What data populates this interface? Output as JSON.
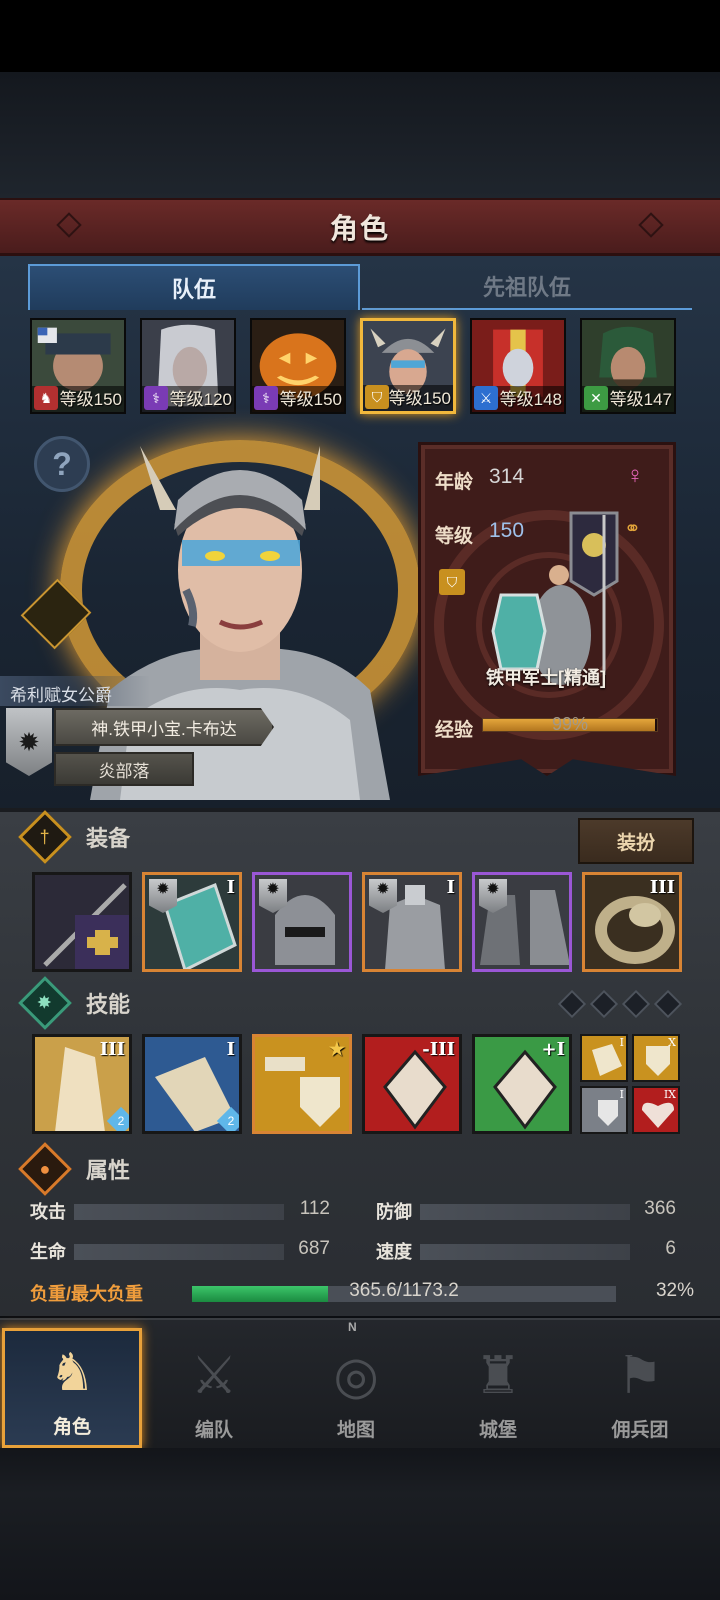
{
  "header": {
    "title": "角色"
  },
  "tabs": [
    {
      "label": "队伍",
      "active": true
    },
    {
      "label": "先祖队伍",
      "active": false
    }
  ],
  "roster": [
    {
      "level": "等级150",
      "class_icon": "horse-icon",
      "class_color": "#b23030",
      "face_color": "#4b5a4a"
    },
    {
      "level": "等级120",
      "class_icon": "staff-icon",
      "class_color": "#7a3bb5",
      "face_color": "#7d7f88"
    },
    {
      "level": "等级150",
      "class_icon": "staff-icon",
      "class_color": "#7a3bb5",
      "face_color": "#d97b1e"
    },
    {
      "level": "等级150",
      "class_icon": "shield-icon",
      "class_color": "#c8901f",
      "face_color": "#6a6f78",
      "selected": true
    },
    {
      "level": "等级148",
      "class_icon": "sword-icon",
      "class_color": "#2d6fd0",
      "face_color": "#b3362d"
    },
    {
      "level": "等级147",
      "class_icon": "crossed-swords-icon",
      "class_color": "#3d9b43",
      "face_color": "#3f5a3c"
    }
  ],
  "character": {
    "title": "希利赋女公爵",
    "name": "神.铁甲小宝.卡布达",
    "tribe": "炎部落",
    "age_label": "年龄",
    "age": "314",
    "level_label": "等级",
    "level": "150",
    "gender_icon": "female-icon",
    "unit": "铁甲军士[精通]",
    "exp_label": "经验",
    "exp_text": "99%",
    "exp_fraction": 0.99
  },
  "equipment": {
    "label": "装备",
    "dress_button": "装扮",
    "slots": [
      {
        "name": "banner-item",
        "rarity": "none",
        "rank": ""
      },
      {
        "name": "shield-item",
        "rarity": "orange",
        "rank": "I"
      },
      {
        "name": "helmet-item",
        "rarity": "purple",
        "rank": ""
      },
      {
        "name": "armor-item",
        "rarity": "orange",
        "rank": "I"
      },
      {
        "name": "boots-item",
        "rarity": "purple",
        "rank": ""
      },
      {
        "name": "ring-item",
        "rarity": "orange",
        "rank": "III"
      }
    ]
  },
  "skills": {
    "label": "技能",
    "slots": [
      {
        "name": "slash-skill",
        "color": "#caa04a",
        "rank": "III",
        "gem": "2"
      },
      {
        "name": "strike-skill",
        "color": "#2e5a92",
        "rank": "I",
        "gem": "2"
      },
      {
        "name": "guard-skill",
        "color": "#c9921f",
        "rank": ""
      },
      {
        "name": "red-crystal-skill",
        "color": "#b21e1e",
        "rank": "-III"
      },
      {
        "name": "green-crystal-skill",
        "color": "#3a9a45",
        "rank": "+I"
      }
    ],
    "passives": [
      {
        "name": "armor-passive",
        "color": "#c9921f",
        "rank": "I"
      },
      {
        "name": "shield-passive",
        "color": "#c9921f",
        "rank": "X"
      },
      {
        "name": "defense-passive",
        "color": "#7b8088",
        "rank": "I"
      },
      {
        "name": "heart-passive",
        "color": "#b21e1e",
        "rank": "IX"
      }
    ]
  },
  "attributes": {
    "label": "属性",
    "attack_label": "攻击",
    "attack": "112",
    "defense_label": "防御",
    "defense": "366",
    "hp_label": "生命",
    "hp": "687",
    "speed_label": "速度",
    "speed": "6",
    "load_label": "负重/最大负重",
    "load": "365.6/1173.2",
    "load_pct": "32%",
    "load_fraction": 0.32
  },
  "nav": [
    {
      "label": "角色",
      "icon": "knight-icon",
      "active": true
    },
    {
      "label": "编队",
      "icon": "formation-icon",
      "active": false
    },
    {
      "label": "地图",
      "icon": "compass-icon",
      "active": false
    },
    {
      "label": "城堡",
      "icon": "castle-icon",
      "active": false
    },
    {
      "label": "佣兵团",
      "icon": "mercenary-icon",
      "active": false
    }
  ],
  "compass_letter": "N"
}
